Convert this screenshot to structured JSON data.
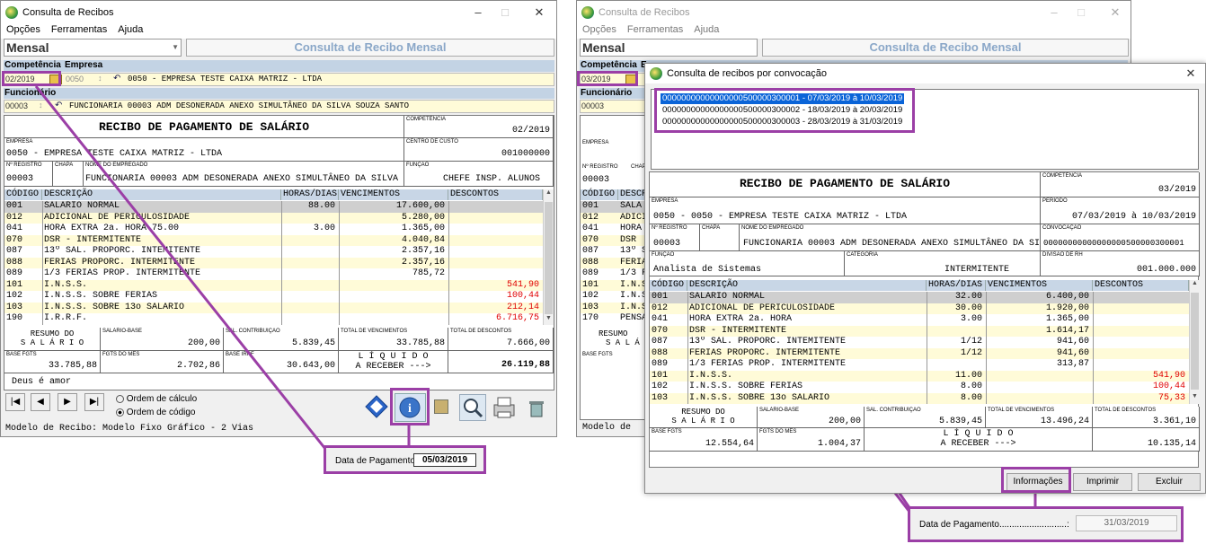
{
  "left": {
    "title": "Consulta de Recibos",
    "menu": [
      "Opções",
      "Ferramentas",
      "Ajuda"
    ],
    "mode_select": "Mensal",
    "banner": "Consulta de Recibo Mensal",
    "competencia_label": "Competência",
    "empresa_label": "Empresa",
    "competencia_value": "02/2019",
    "empresa_code": "0050",
    "empresa_name": "0050 - EMPRESA TESTE CAIXA MATRIZ -  LTDA",
    "funcionario_label": "Funcionário",
    "func_code": "00003",
    "func_name": "FUNCIONARIA 00003 ADM DESONERADA ANEXO SIMULTÂNEO DA SILVA SOUZA SANTO",
    "receipt_title": "RECIBO DE PAGAMENTO DE SALÁRIO",
    "comp_lbl": "COMPETÊNCIA",
    "comp_val": "02/2019",
    "emp_lbl": "EMPRESA",
    "emp_val": "0050 - EMPRESA TESTE CAIXA MATRIZ -  LTDA",
    "cc_lbl": "CENTRO DE CUSTO",
    "cc_val": "001000000",
    "reg_lbl": "Nº REGISTRO",
    "chapa_lbl": "CHAPA",
    "nome_lbl": "NOME DO EMPREGADO",
    "funcao_lbl": "FUNÇÃO",
    "reg_val": "00003",
    "nome_val": "FUNCIONARIA 00003 ADM DESONERADA ANEXO SIMULTÂNEO DA SILVA S",
    "funcao_val": "CHEFE INSP. ALUNOS",
    "cols": [
      "CÓDIGO",
      "DESCRIÇÃO",
      "HORAS/DIAS",
      "VENCIMENTOS",
      "DESCONTOS"
    ],
    "rows": [
      {
        "c": "001",
        "d": "SALÁRIO NORMAL",
        "h": "88.00",
        "v": "17.600,00",
        "x": ""
      },
      {
        "c": "012",
        "d": "ADICIONAL DE PERICULOSIDADE",
        "h": "",
        "v": "5.280,00",
        "x": ""
      },
      {
        "c": "041",
        "d": "HORA EXTRA 2a. HORA 75.00",
        "h": "3.00",
        "v": "1.365,00",
        "x": ""
      },
      {
        "c": "070",
        "d": "DSR - INTERMITENTE",
        "h": "",
        "v": "4.040,84",
        "x": ""
      },
      {
        "c": "087",
        "d": "13º SAL. PROPORC. INTEMITENTE",
        "h": "",
        "v": "2.357,16",
        "x": ""
      },
      {
        "c": "088",
        "d": "FÉRIAS PROPORC. INTERMITENTE",
        "h": "",
        "v": "2.357,16",
        "x": ""
      },
      {
        "c": "089",
        "d": "1/3 FÉRIAS PROP. INTERMITENTE",
        "h": "",
        "v": "785,72",
        "x": ""
      },
      {
        "c": "101",
        "d": "I.N.S.S.",
        "h": "",
        "v": "",
        "x": "541,90"
      },
      {
        "c": "102",
        "d": "I.N.S.S. SOBRE FÉRIAS",
        "h": "",
        "v": "",
        "x": "100,44"
      },
      {
        "c": "103",
        "d": "I.N.S.S. SOBRE 13o SALÁRIO",
        "h": "",
        "v": "",
        "x": "212,14"
      },
      {
        "c": "190",
        "d": "I.R.R.F.",
        "h": "",
        "v": "",
        "x": "6.716,75"
      }
    ],
    "resumo": "RESUMO DO",
    "salario": "S A L Á R I O",
    "sb_lbl": "SALÁRIO-BASE",
    "sb_val": "200,00",
    "sc_lbl": "SAL. CONTRIBUIÇÃO",
    "sc_val": "5.839,45",
    "tv_lbl": "TOTAL DE VENCIMENTOS",
    "tv_val": "33.785,88",
    "td_lbl": "TOTAL DE DESCONTOS",
    "td_val": "7.666,00",
    "bf_lbl": "BASE FGTS",
    "bf_val": "33.785,88",
    "fm_lbl": "FGTS DO MÊS",
    "fm_val": "2.702,86",
    "bi_lbl": "BASE IRRF",
    "bi_val": "30.643,00",
    "liq1": "L Í Q U I D O",
    "liq2": "A RECEBER --->",
    "liq_val": "26.119,88",
    "msg": "Deus é amor",
    "order1": "Ordem de cálculo",
    "order2": "Ordem de código",
    "status": "Modelo de Recibo: Modelo Fixo Gráfico - 2 Vias",
    "popup_label": "Data de Pagamento:",
    "popup_value": "05/03/2019"
  },
  "right": {
    "title": "Consulta de Recibos",
    "menu": [
      "Opções",
      "Ferramentas",
      "Ajuda"
    ],
    "mode_select": "Mensal",
    "banner": "Consulta de Recibo Mensal",
    "competencia_label": "Competência",
    "empresa_label": "E",
    "competencia_value": "03/2019",
    "funcionario_label": "Funcionário",
    "func_code": "00003",
    "bg_codes": [
      "001",
      "012",
      "041",
      "070",
      "087",
      "088",
      "089",
      "101",
      "102",
      "103",
      "170"
    ],
    "bg_desc": [
      "SALÁ",
      "ADICI",
      "HORA",
      "DSR",
      "13º S",
      "FÉRIA",
      "1/3 F",
      "I.N.S",
      "I.N.S",
      "I.N.S",
      "PENSÃ"
    ],
    "bg_resumo": "RESUMO",
    "bg_salario": "S A L Á",
    "bg_bf": "BASE FGTS",
    "bg_emp": "EMPRESA",
    "bg_reg": "Nº REGISTRO",
    "bg_chapa": "CHAPA",
    "bg_reg_val": "00003",
    "bg_cols": [
      "CÓDIGO",
      "DESCR"
    ],
    "bg_status": "Modelo de",
    "dlg_title": "Consulta de recibos por convocação",
    "tree": [
      "00000000000000000500000300001 - 07/03/2019 à 10/03/2019",
      "00000000000000000500000300002 - 18/03/2019 à 20/03/2019",
      "00000000000000000500000300003 - 28/03/2019 à 31/03/2019"
    ],
    "receipt_title": "RECIBO DE PAGAMENTO DE SALÁRIO",
    "comp_lbl": "COMPETÊNCIA",
    "comp_val": "03/2019",
    "emp_lbl": "EMPRESA",
    "emp_val": "0050 - 0050 - EMPRESA TESTE CAIXA MATRIZ -  LTDA",
    "per_lbl": "PERÍODO",
    "per_val": "07/03/2019 à 10/03/2019",
    "reg_lbl": "Nº REGISTRO",
    "chapa_lbl": "CHAPA",
    "nome_lbl": "NOME DO EMPREGADO",
    "conv_lbl": "CONVOCAÇÃO",
    "reg_val": "00003",
    "nome_val": "FUNCIONARIA 00003 ADM DESONERADA ANEXO SIMULTÂNEO DA SI",
    "conv_val": "00000000000000000500000300001",
    "funcao_lbl": "FUNÇÃO",
    "cat_lbl": "CATEGORIA",
    "div_lbl": "DIVISÃO DE RH",
    "funcao_val": "Analista de Sistemas",
    "cat_val": "INTERMITENTE",
    "div_val": "001.000.000",
    "cols": [
      "CÓDIGO",
      "DESCRIÇÃO",
      "HORAS/DIAS",
      "VENCIMENTOS",
      "DESCONTOS"
    ],
    "rows": [
      {
        "c": "001",
        "d": "SALÁRIO NORMAL",
        "h": "32.00",
        "v": "6.400,00",
        "x": ""
      },
      {
        "c": "012",
        "d": "ADICIONAL DE PERICULOSIDADE",
        "h": "30.00",
        "v": "1.920,00",
        "x": ""
      },
      {
        "c": "041",
        "d": "HORA EXTRA 2a. HORA",
        "h": "3.00",
        "v": "1.365,00",
        "x": ""
      },
      {
        "c": "070",
        "d": "DSR - INTERMITENTE",
        "h": "",
        "v": "1.614,17",
        "x": ""
      },
      {
        "c": "087",
        "d": "13º SAL. PROPORC. INTEMITENTE",
        "h": "1/12",
        "v": "941,60",
        "x": ""
      },
      {
        "c": "088",
        "d": "FÉRIAS PROPORC. INTERMITENTE",
        "h": "1/12",
        "v": "941,60",
        "x": ""
      },
      {
        "c": "089",
        "d": "1/3 FÉRIAS PROP. INTERMITENTE",
        "h": "",
        "v": "313,87",
        "x": ""
      },
      {
        "c": "101",
        "d": "I.N.S.S.",
        "h": "11.00",
        "v": "",
        "x": "541,90"
      },
      {
        "c": "102",
        "d": "I.N.S.S. SOBRE FÉRIAS",
        "h": "8.00",
        "v": "",
        "x": "100,44"
      },
      {
        "c": "103",
        "d": "I.N.S.S. SOBRE 13o SALÁRIO",
        "h": "8.00",
        "v": "",
        "x": "75,33"
      }
    ],
    "resumo": "RESUMO DO",
    "salario": "S A L Á R I O",
    "sb_lbl": "SALÁRIO-BASE",
    "sb_val": "200,00",
    "sc_lbl": "SAL. CONTRIBUIÇÃO",
    "sc_val": "5.839,45",
    "tv_lbl": "TOTAL DE VENCIMENTOS",
    "tv_val": "13.496,24",
    "td_lbl": "TOTAL DE DESCONTOS",
    "td_val": "3.361,10",
    "bf_lbl": "BASE FGTS",
    "bf_val": "12.554,64",
    "fm_lbl": "FGTS DO MÊS",
    "fm_val": "1.004,37",
    "liq1": "L Í Q U I D O",
    "liq2": "A RECEBER --->",
    "liq_val": "10.135,14",
    "btn_info": "Informações",
    "btn_print": "Imprimir",
    "btn_del": "Excluir",
    "popup_label": "Data de Pagamento...........................:",
    "popup_value": "31/03/2019"
  }
}
